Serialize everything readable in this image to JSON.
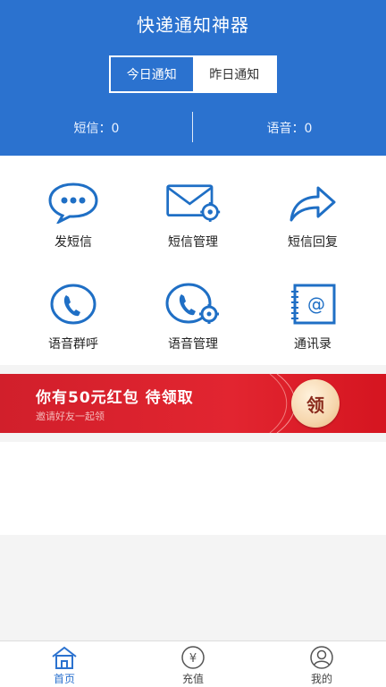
{
  "header": {
    "title": "快递通知神器",
    "tabs": [
      {
        "label": "今日通知",
        "active": true
      },
      {
        "label": "昨日通知",
        "active": false
      }
    ],
    "sms_count": "短信：0",
    "voice_count": "语音：0"
  },
  "grid": {
    "items": [
      {
        "label": "发短信",
        "icon": "sms-chat-icon"
      },
      {
        "label": "短信管理",
        "icon": "sms-settings-icon"
      },
      {
        "label": "短信回复",
        "icon": "reply-icon"
      },
      {
        "label": "语音群呼",
        "icon": "phone-icon"
      },
      {
        "label": "语音管理",
        "icon": "voice-settings-icon"
      },
      {
        "label": "通讯录",
        "icon": "contacts-icon"
      }
    ]
  },
  "banner": {
    "title": "你有50元红包   待领取",
    "subtitle": "邀请好友一起领",
    "claim_label": "领"
  },
  "tabbar": {
    "items": [
      {
        "label": "首页",
        "icon": "home-icon",
        "active": true
      },
      {
        "label": "充值",
        "icon": "yuan-icon",
        "active": false
      },
      {
        "label": "我的",
        "icon": "user-icon",
        "active": false
      }
    ]
  },
  "colors": {
    "primary": "#2b72cf",
    "banner_red": "#d11f2b",
    "icon_blue": "#1f6fc5"
  }
}
